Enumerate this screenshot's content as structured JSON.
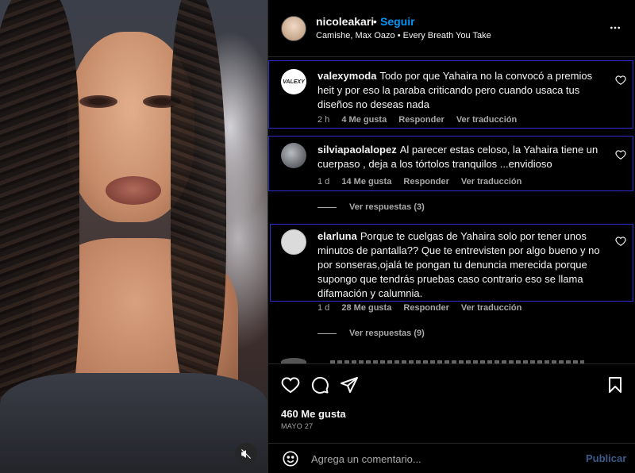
{
  "post": {
    "username": "nicoleakari",
    "separator": "•",
    "follow_label": "Seguir",
    "audio": "Camishe, Max Oazo • Every Breath You Take",
    "more_icon": "more-horizontal-icon"
  },
  "comments": [
    {
      "username": "valexymoda",
      "text": "Todo por que Yahaira no la convocó a premios heit y por eso la paraba criticando pero cuando usaca tus diseños no deseas nada",
      "time": "2 h",
      "likes": "4 Me gusta",
      "reply_label": "Responder",
      "translate_label": "Ver traducción",
      "avatar_text": "VALEXY"
    },
    {
      "username": "silviapaolalopez",
      "text": "Al parecer estas celoso, la Yahaira tiene un cuerpaso , deja a los tórtolos tranquilos ...envidioso",
      "time": "1 d",
      "likes": "14 Me gusta",
      "reply_label": "Responder",
      "translate_label": "Ver traducción",
      "view_replies": "Ver respuestas (3)"
    },
    {
      "username": "elarluna",
      "text": "Porque te cuelgas de Yahaira solo por tener unos minutos de pantalla?? Que te entrevisten por algo bueno y no por sonseras,ojalá te pongan tu denuncia merecida porque supongo que tendrás pruebas caso contrario eso se llama difamación y calumnia.",
      "time": "1 d",
      "likes": "28 Me gusta",
      "reply_label": "Responder",
      "translate_label": "Ver traducción",
      "view_replies": "Ver respuestas (9)"
    }
  ],
  "actions": {
    "likes": "460 Me gusta",
    "date": "MAYO 27"
  },
  "add_comment": {
    "placeholder": "Agrega un comentario...",
    "post_label": "Publicar"
  },
  "colors": {
    "accent": "#0095f6",
    "secondary_text": "#a8a8a8",
    "highlight_border": "#2c2ccf"
  }
}
